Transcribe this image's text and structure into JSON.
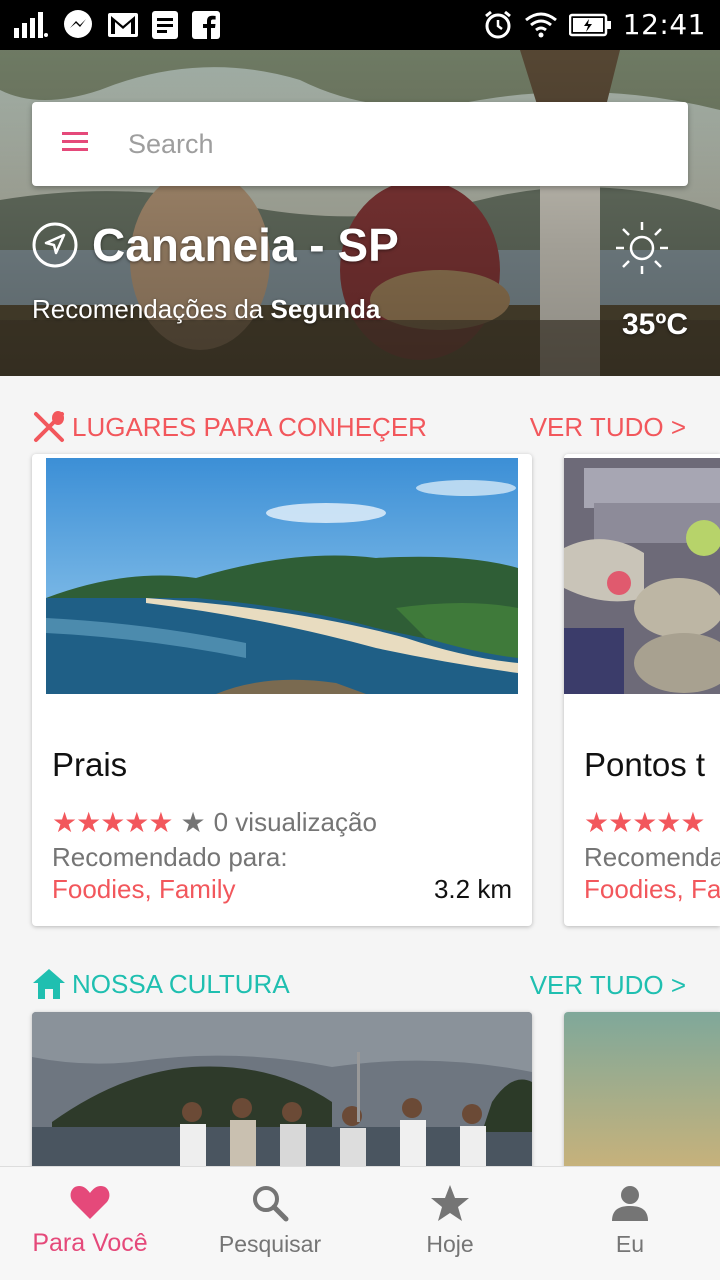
{
  "status_bar": {
    "time": "12:41"
  },
  "search": {
    "placeholder": "Search"
  },
  "location": {
    "city": "Cananeia - SP",
    "recommendation_prefix": "Recomendações da",
    "recommendation_day": "Segunda",
    "temperature": "35ºC"
  },
  "sections": [
    {
      "title": "LUGARES PARA CONHEÇER",
      "see_all": "VER TUDO >",
      "accent": "#f2575c",
      "cards": [
        {
          "title": "Prais",
          "rating": 5,
          "views": "0 visualização",
          "recommended_label": "Recomendado para:",
          "tags": "Foodies, Family",
          "distance": "3.2 km"
        },
        {
          "title": "Pontos t",
          "rating": 5,
          "views": "",
          "recommended_label": "Recomenda",
          "tags": "Foodies, Fa",
          "distance": ""
        }
      ]
    },
    {
      "title": "NOSSA CULTURA",
      "see_all": "VER TUDO >",
      "accent": "#1fbfb0"
    }
  ],
  "bottom_nav": [
    {
      "label": "Para Você",
      "icon": "heart-icon",
      "active": true
    },
    {
      "label": "Pesquisar",
      "icon": "search-icon",
      "active": false
    },
    {
      "label": "Hoje",
      "icon": "star-icon",
      "active": false
    },
    {
      "label": "Eu",
      "icon": "person-icon",
      "active": false
    }
  ],
  "colors": {
    "primary_pink": "#e5497a",
    "coral": "#f2575c",
    "teal": "#1fbfb0"
  }
}
